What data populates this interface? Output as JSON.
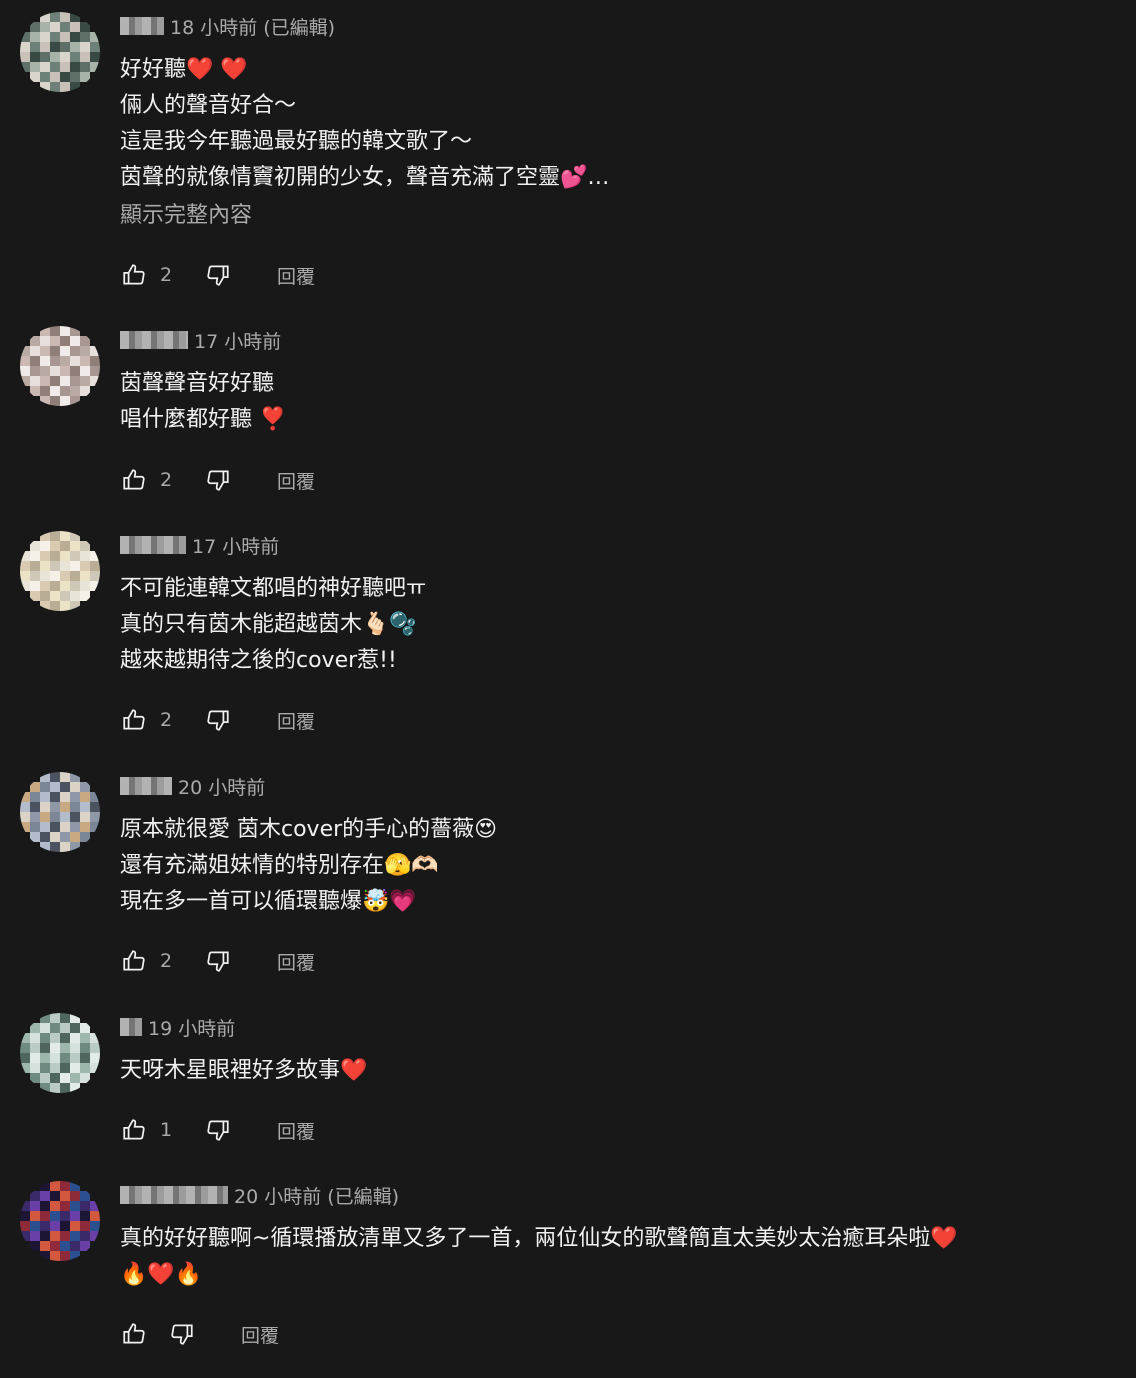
{
  "comments": [
    {
      "time": "18 小時前",
      "edited": "(已編輯)",
      "text": "好好聽❤️ ❤️\n倆人的聲音好合～\n這是我今年聽過最好聽的韓文歌了～\n茵聲的就像情竇初開的少女，聲音充滿了空靈💕…",
      "more": "顯示完整內容",
      "likes": "2",
      "reply_label": "回覆",
      "avatar_colors": [
        "#5d6f66",
        "#a7b3a9",
        "#d9d4cc",
        "#6e8178",
        "#c9c0b9",
        "#394a44"
      ]
    },
    {
      "time": "17 小時前",
      "edited": "",
      "text": "茵聲聲音好好聽\n唱什麼都好聽 ❣️",
      "more": "",
      "likes": "2",
      "reply_label": "回覆",
      "avatar_colors": [
        "#b9aaa3",
        "#e7dfdc",
        "#cbb8b3",
        "#8f7f78",
        "#f0ebe8",
        "#a79691"
      ]
    },
    {
      "time": "17 小時前",
      "edited": "",
      "text": "不可能連韓文都唱的神好聽吧ㅠ\n真的只有茵木能超越茵木🫰🏻🫧\n越來越期待之後的cover惹!!",
      "more": "",
      "likes": "2",
      "reply_label": "回覆",
      "avatar_colors": [
        "#e9e4d8",
        "#f5f1e8",
        "#d8cbb1",
        "#b9ad95",
        "#ece2c6",
        "#cfc8b8"
      ]
    },
    {
      "time": "20 小時前",
      "edited": "",
      "text": "原本就很愛 茵木cover的手心的薔薇😍\n還有充滿姐妹情的特別存在🫣🫶🏻\n現在多一首可以循環聽爆🤯💗",
      "more": "",
      "likes": "2",
      "reply_label": "回覆",
      "avatar_colors": [
        "#c9a982",
        "#7b8696",
        "#b3bccb",
        "#4b5360",
        "#dcd3c7",
        "#8e98a7"
      ]
    },
    {
      "time": "19 小時前",
      "edited": "",
      "text": "天呀木星眼裡好多故事❤️",
      "more": "",
      "likes": "1",
      "reply_label": "回覆",
      "avatar_colors": [
        "#9db7ad",
        "#d5e1dc",
        "#6f8a80",
        "#b9cbc4",
        "#4f665e",
        "#e3ebe8"
      ]
    },
    {
      "time": "20 小時前",
      "edited": "(已編輯)",
      "text": "真的好好聽啊~循環播放清單又多了一首，兩位仙女的歌聲簡直太美妙太治癒耳朵啦❤️\n🔥❤️🔥",
      "more": "",
      "likes": "",
      "reply_label": "回覆",
      "avatar_colors": [
        "#3a2a6a",
        "#6b3fa8",
        "#1c1533",
        "#d2583f",
        "#8d2b3a",
        "#2b4f8f"
      ]
    }
  ]
}
